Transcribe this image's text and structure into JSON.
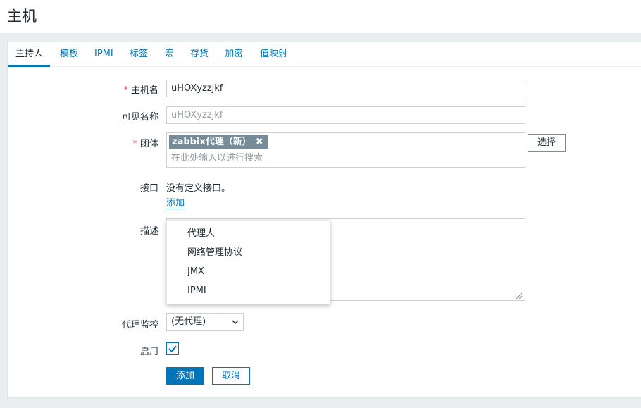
{
  "page": {
    "title": "主机"
  },
  "tabs": [
    {
      "label": "主持人",
      "active": true
    },
    {
      "label": "模板"
    },
    {
      "label": "IPMI"
    },
    {
      "label": "标签"
    },
    {
      "label": "宏"
    },
    {
      "label": "存货"
    },
    {
      "label": "加密"
    },
    {
      "label": "值映射"
    }
  ],
  "form": {
    "required_mark": "*",
    "host_name": {
      "label": "主机名",
      "value": "uHOXyzzjkf"
    },
    "visible_name": {
      "label": "可见名称",
      "placeholder": "uHOXyzzjkf"
    },
    "groups": {
      "label": "团体",
      "chips": [
        {
          "label": "zabbix代理（新）"
        }
      ],
      "search_placeholder": "在此处输入以进行搜索",
      "select_button": "选择"
    },
    "interfaces": {
      "label": "接口",
      "empty_text": "没有定义接口。",
      "add_link": "添加"
    },
    "description": {
      "label": "描述",
      "value": ""
    },
    "proxy": {
      "label": "代理监控",
      "selected": "(无代理)"
    },
    "enabled": {
      "label": "启用",
      "checked": true
    },
    "actions": {
      "add": "添加",
      "cancel": "取消"
    }
  },
  "interface_menu": {
    "items": [
      {
        "label": "代理人"
      },
      {
        "label": "网络管理协议"
      },
      {
        "label": "JMX"
      },
      {
        "label": "IPMI"
      }
    ]
  },
  "colors": {
    "accent": "#0275b8",
    "required": "#e45959",
    "chip": "#768d99"
  },
  "icons": {
    "chip_remove": "close-icon",
    "select_arrow": "chevron-down-icon",
    "checkbox": "checkmark-icon",
    "resize": "resize-grip-icon"
  }
}
